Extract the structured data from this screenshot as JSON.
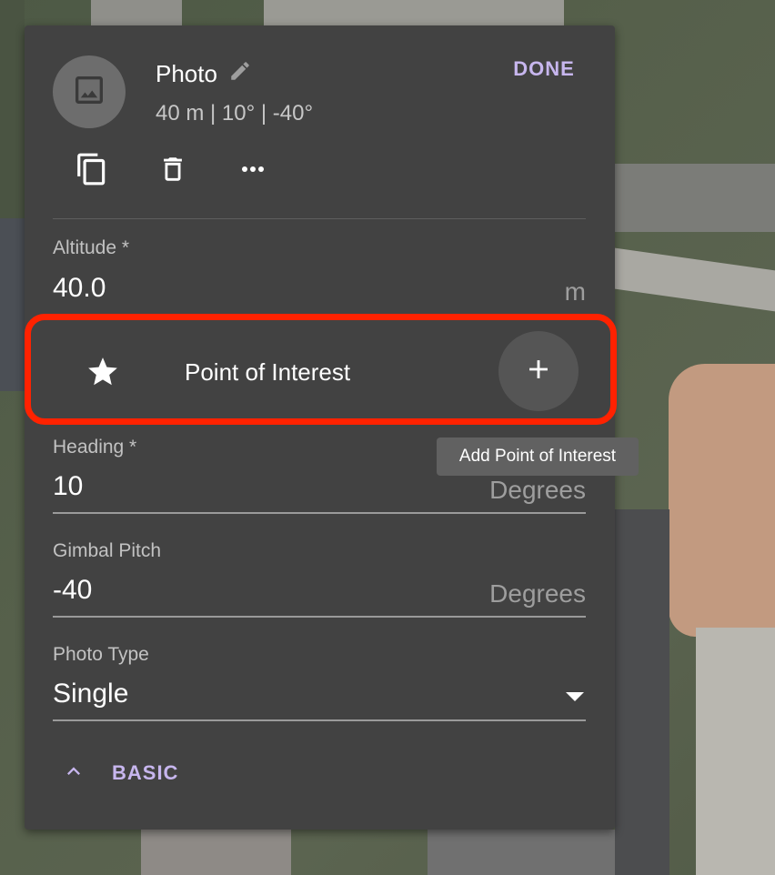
{
  "colors": {
    "panel_bg": "#424242",
    "accent": "#c7b6ee",
    "highlight": "#ff2200",
    "tooltip_bg": "#616161"
  },
  "header": {
    "avatar_icon": "image-icon",
    "title": "Photo",
    "title_edit_icon": "pencil-icon",
    "subtitle": "40 m | 10° | -40°",
    "done_label": "DONE"
  },
  "toolbar": {
    "icons": [
      "copy-icon",
      "trash-icon",
      "more-horizontal-icon"
    ]
  },
  "fields": {
    "altitude": {
      "label": "Altitude *",
      "value": "40.0",
      "unit": "m"
    },
    "heading": {
      "label": "Heading *",
      "value": "10",
      "unit": "Degrees"
    },
    "gimbal_pitch": {
      "label": "Gimbal Pitch",
      "value": "-40",
      "unit": "Degrees"
    },
    "photo_type": {
      "label": "Photo Type",
      "value": "Single"
    }
  },
  "poi": {
    "icon": "star-icon",
    "label": "Point of Interest",
    "add_icon": "plus-icon",
    "tooltip": "Add Point of Interest"
  },
  "footer": {
    "toggle_icon": "chevron-up-icon",
    "basic_label": "BASIC"
  }
}
